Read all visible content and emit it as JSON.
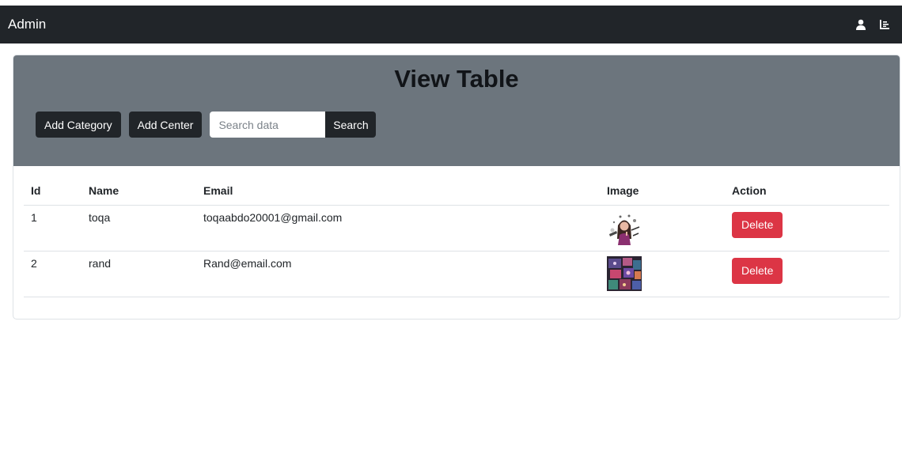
{
  "navbar": {
    "brand": "Admin",
    "icons": [
      "user-icon",
      "list-icon"
    ]
  },
  "header": {
    "title": "View Table",
    "add_category_label": "Add Category",
    "add_center_label": "Add Center",
    "search_placeholder": "Search data",
    "search_value": "",
    "search_label": "Search"
  },
  "table": {
    "columns": [
      "Id",
      "Name",
      "Email",
      "Image",
      "Action"
    ],
    "rows": [
      {
        "id": "1",
        "name": "toqa",
        "email": "toqaabdo20001@gmail.com",
        "image": "makeup-artist-illustration",
        "action": "Delete"
      },
      {
        "id": "2",
        "name": "rand",
        "email": "Rand@email.com",
        "image": "makeup-palettes-photo",
        "action": "Delete"
      }
    ]
  },
  "colors": {
    "navbar": "#212529",
    "header": "#6c757d",
    "danger": "#dc3545"
  }
}
